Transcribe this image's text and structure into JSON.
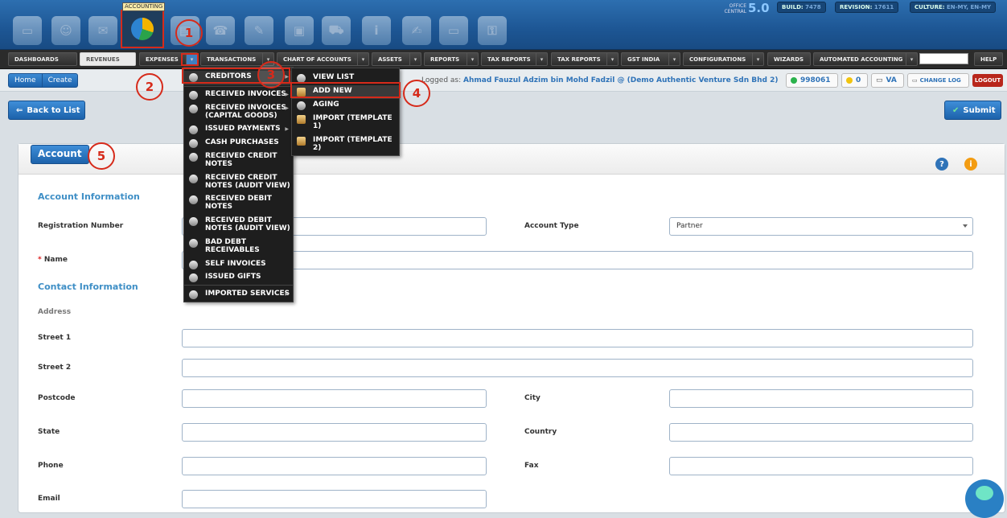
{
  "header": {
    "brand": "OFFICE CENTRAL",
    "version": "5.0",
    "build_label": "BUILD:",
    "build": "7478",
    "revision_label": "REVISION:",
    "revision": "17611",
    "culture_label": "CULTURE:",
    "culture": "EN-MY, EN-MY",
    "tooltip": "ACCOUNTING",
    "app_icons": [
      "desktop-icon",
      "user-icon",
      "mail-icon",
      "accounting-icon",
      "document-icon",
      "phone-icon",
      "chat-icon",
      "box-icon",
      "truck-icon",
      "info-icon",
      "notes-icon",
      "monitor-icon",
      "lock-icon"
    ]
  },
  "menu": {
    "items": [
      "DASHBOARDS",
      "REVENUES",
      "EXPENSES",
      "TRANSACTIONS",
      "CHART OF ACCOUNTS",
      "ASSETS",
      "REPORTS",
      "TAX REPORTS",
      "TAX REPORTS",
      "GST INDIA",
      "CONFIGURATIONS",
      "WIZARDS",
      "AUTOMATED ACCOUNTING",
      "HELP"
    ]
  },
  "breadcrumb": {
    "home": "Home",
    "current": "Create"
  },
  "user": {
    "prefix": "Logged as:",
    "name": "Ahmad Fauzul Adzim bin Mohd Fadzil @ (Demo Authentic Venture Sdn Bhd 2)",
    "online_count": "998061",
    "alerts": "0",
    "va": "VA",
    "changelog": "CHANGE LOG",
    "logout": "LOGOUT"
  },
  "toolbar": {
    "back": "Back to List",
    "submit": "Submit"
  },
  "expenses_menu": {
    "items": [
      "CREDITORS",
      "RECEIVED INVOICES",
      "RECEIVED INVOICES (CAPITAL GOODS)",
      "ISSUED PAYMENTS",
      "CASH PURCHASES",
      "RECEIVED CREDIT NOTES",
      "RECEIVED CREDIT NOTES (AUDIT VIEW)",
      "RECEIVED DEBIT NOTES",
      "RECEIVED DEBIT NOTES (AUDIT VIEW)",
      "BAD DEBT RECEIVABLES",
      "SELF INVOICES",
      "ISSUED GIFTS",
      "IMPORTED SERVICES"
    ]
  },
  "creditors_menu": {
    "items": [
      "VIEW LIST",
      "ADD NEW",
      "AGING",
      "IMPORT (TEMPLATE 1)",
      "IMPORT (TEMPLATE 2)"
    ]
  },
  "form": {
    "tab": "Account",
    "account_info": "Account Information",
    "registration_number": "Registration Number",
    "account_type": "Account Type",
    "account_type_value": "Partner",
    "name_required": "*",
    "name": "Name",
    "contact_info": "Contact Information",
    "address": "Address",
    "street1": "Street 1",
    "street2": "Street 2",
    "postcode": "Postcode",
    "city": "City",
    "state": "State",
    "country": "Country",
    "phone": "Phone",
    "fax": "Fax",
    "email": "Email"
  },
  "annotations": [
    "1",
    "2",
    "3",
    "4",
    "5"
  ],
  "colors": {
    "accent": "#1d63ad",
    "annotation": "#d62a1a",
    "section": "#3f8fc6"
  }
}
